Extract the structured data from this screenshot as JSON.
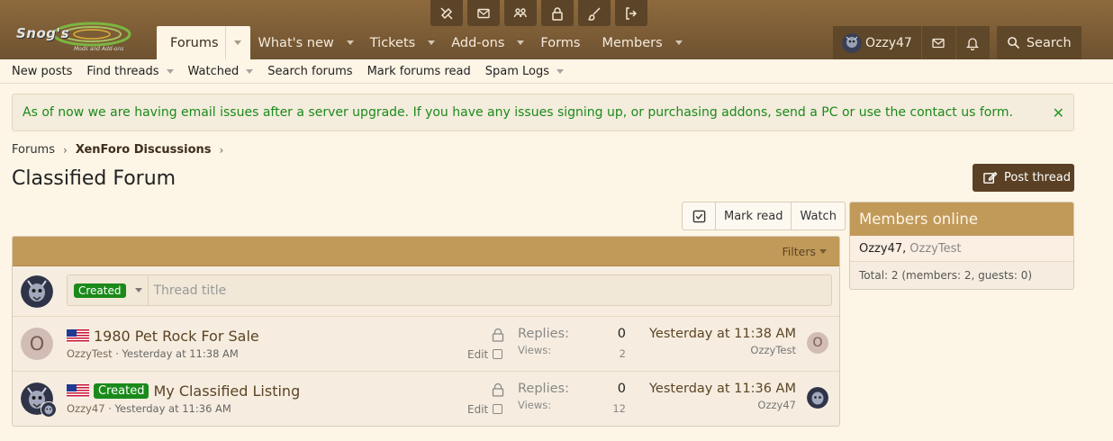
{
  "header": {
    "logo_text": "Snog's",
    "logo_sub": "Mods and Add-ons",
    "staff_icons": [
      "tools-icon",
      "mail-icon",
      "users-gear-icon",
      "lock-icon",
      "brush-icon",
      "logout-icon"
    ],
    "nav": [
      {
        "label": "Forums",
        "active": true,
        "caret": true
      },
      {
        "label": "What's new",
        "caret": true
      },
      {
        "label": "Tickets",
        "caret": true
      },
      {
        "label": "Add-ons",
        "caret": true
      },
      {
        "label": "Forms",
        "caret": false
      },
      {
        "label": "Members",
        "caret": true
      }
    ],
    "user_name": "Ozzy47",
    "search_label": "Search"
  },
  "subnav": [
    "New posts",
    "Find threads",
    "Watched",
    "Search forums",
    "Mark forums read",
    "Spam Logs"
  ],
  "notice": {
    "text": "As of now we are having email issues after a server upgrade. If you have any issues signing up, or purchasing addons, send a PC or use the contact us form.",
    "close": "✕"
  },
  "breadcrumb": {
    "root": "Forums",
    "current": "XenForo Discussions"
  },
  "page": {
    "title": "Classified Forum",
    "post_thread": "Post thread",
    "mark_read": "Mark read",
    "watch": "Watch"
  },
  "thread_list": {
    "filters_label": "Filters",
    "quick_prefix": "Created",
    "quick_placeholder": "Thread title",
    "threads": [
      {
        "avatar_letter": "O",
        "prefix": "",
        "title": "1980 Pet Rock For Sale",
        "author": "OzzyTest",
        "date": "Yesterday at 11:38 AM",
        "edit": "Edit",
        "replies_label": "Replies:",
        "replies": "0",
        "views_label": "Views:",
        "views": "2",
        "latest_date": "Yesterday at 11:38 AM",
        "latest_user": "OzzyTest",
        "latest_letter": "O"
      },
      {
        "avatar_letter": "",
        "prefix": "Created",
        "title": "My Classified Listing",
        "author": "Ozzy47",
        "date": "Yesterday at 11:36 AM",
        "edit": "Edit",
        "replies_label": "Replies:",
        "replies": "0",
        "views_label": "Views:",
        "views": "12",
        "latest_date": "Yesterday at 11:36 AM",
        "latest_user": "Ozzy47",
        "latest_letter": ""
      }
    ]
  },
  "members_online": {
    "title": "Members online",
    "members": [
      "Ozzy47",
      "OzzyTest"
    ],
    "total": "Total: 2 (members: 2, guests: 0)"
  },
  "colors": {
    "header_brown": "#8e6a3d",
    "accent_gold": "#c19a5a",
    "dark_button": "#5a4024",
    "prefix_green": "#1a8a1a",
    "notice_green": "#1b8a1b"
  }
}
